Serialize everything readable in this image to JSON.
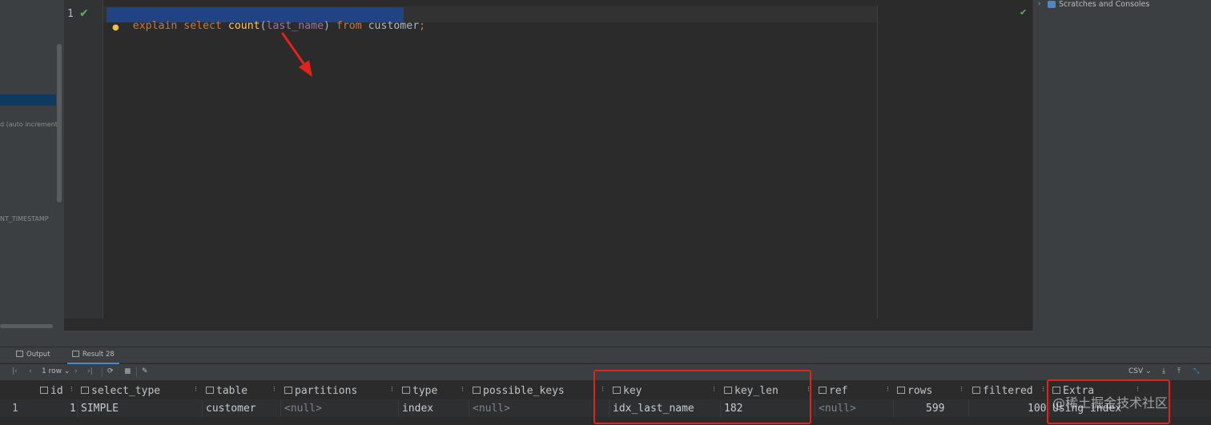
{
  "left_panel": {
    "column_fragments": [
      "d (auto increment)",
      "NT_TIMESTAMP"
    ]
  },
  "editor": {
    "line_number": "1",
    "tokens": [
      {
        "text": "explain",
        "kind": "kw"
      },
      {
        "text": " ",
        "kind": "tx"
      },
      {
        "text": "select",
        "kind": "kw"
      },
      {
        "text": " ",
        "kind": "tx"
      },
      {
        "text": "count",
        "kind": "fn"
      },
      {
        "text": "(",
        "kind": "tx"
      },
      {
        "text": "last_name",
        "kind": "pm"
      },
      {
        "text": ") ",
        "kind": "tx"
      },
      {
        "text": "from",
        "kind": "kw"
      },
      {
        "text": " customer",
        "kind": "tx"
      },
      {
        "text": ";",
        "kind": "kw"
      }
    ],
    "icons": [
      "check-icon",
      "lightbulb-icon"
    ]
  },
  "right_panel": {
    "tree_item": "Scratches and Consoles"
  },
  "bottom": {
    "tabs": [
      {
        "label": "Output",
        "icon": "console-icon"
      },
      {
        "label": "Result 28",
        "icon": "table-icon",
        "active": true
      }
    ],
    "toolbar": {
      "rows_label": "1 row",
      "export_format": "CSV"
    },
    "columns": [
      "id",
      "select_type",
      "table",
      "partitions",
      "type",
      "possible_keys",
      "key",
      "key_len",
      "ref",
      "rows",
      "filtered",
      "Extra"
    ],
    "row_number": "1",
    "row": {
      "id": "1",
      "select_type": "SIMPLE",
      "table": "customer",
      "partitions": "<null>",
      "type": "index",
      "possible_keys": "<null>",
      "key": "idx_last_name",
      "key_len": "182",
      "ref": "<null>",
      "rows": "599",
      "filtered": "100",
      "Extra": "Using index"
    }
  },
  "watermark": "@稀土掘金技术社区",
  "colors": {
    "annotation_red": "#e2231a",
    "keyword": "#cc7832",
    "function": "#ffc66d",
    "parameter": "#9876aa",
    "selection": "#214283"
  }
}
